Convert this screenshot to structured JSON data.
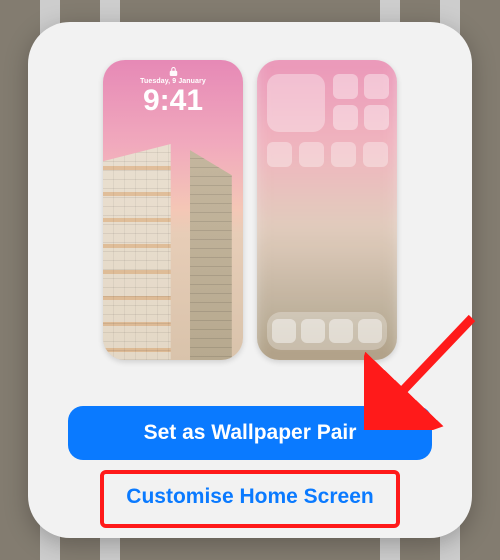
{
  "lock_screen": {
    "date_label": "Tuesday, 9 January",
    "time_label": "9:41"
  },
  "buttons": {
    "primary_label": "Set as Wallpaper Pair",
    "secondary_label": "Customise Home Screen"
  },
  "annotations": {
    "arrow_target": "set-as-wallpaper-pair-button",
    "highlight_target": "customise-home-screen-button"
  },
  "colors": {
    "accent": "#0a7aff",
    "annotation_red": "#ff1a1a"
  }
}
